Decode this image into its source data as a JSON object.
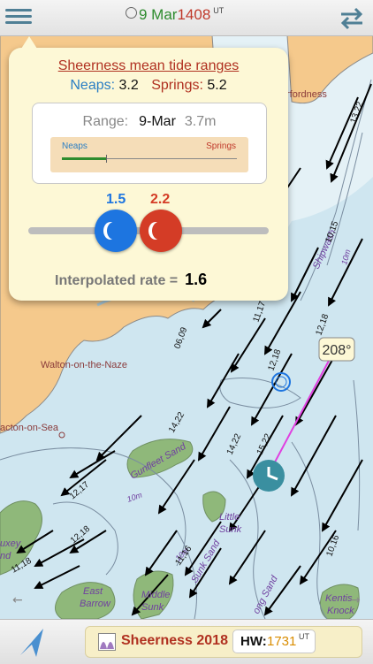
{
  "topbar": {
    "date": "9 Mar",
    "time": "1408",
    "time_suffix": "UT",
    "menu_icon": "hamburger-menu-icon",
    "swap_icon": "swap-arrows-icon"
  },
  "map": {
    "labels": {
      "walton": "Walton-on-the-Naze",
      "clacton": "acton-on-Sea",
      "gunfleet": "Gunfleet Sand",
      "little_sunk_1": "Little",
      "little_sunk_2": "Sunk",
      "middle_sunk_1": "Middle",
      "middle_sunk_2": "Sunk",
      "east_barrow_1": "East",
      "east_barrow_2": "Barrow",
      "kentish_1": "Kentis",
      "kentish_2": "Knock",
      "uxey_1": "uxey",
      "uxey_2": "nd",
      "shipwash": "Shipwash",
      "sunk_sand": "Sunk Sand",
      "long_sand": "ong Sand",
      "harfordness": "rfordness",
      "depth_10m_a": "10m",
      "depth_10m_b": "10m",
      "depth_10m_c": "10m"
    },
    "rates": [
      "13,22",
      "10,15",
      "12,18",
      "11,17",
      "06,09",
      "12,18",
      "14,22",
      "14,22",
      "15,22",
      "12,17",
      "12,18",
      "11,16",
      "11,18",
      "10,16"
    ],
    "heading": "208°",
    "colors": {
      "land": "#f5c98c",
      "sea": "#cfe6f0",
      "shallow": "#8fb87a",
      "track": "#e040e0",
      "vessel": "#3a8fa0"
    }
  },
  "popup": {
    "title": "Sheerness mean tide ranges",
    "neaps_label": "Neaps:",
    "neaps_value": "3.2",
    "springs_label": "Springs:",
    "springs_value": "5.2",
    "range_label": "Range:",
    "range_date": "9-Mar",
    "range_value": "3.7m",
    "bar_neaps": "Neaps",
    "bar_springs": "Springs",
    "bar_fraction": 0.25,
    "slider_neaps": "1.5",
    "slider_springs": "2.2",
    "interp_label": "Interpolated rate =",
    "interp_value": "1.6"
  },
  "bottombar": {
    "nav_icon": "navigation-arrow-icon",
    "station": "Sheerness 2018",
    "hw_label": "HW:",
    "hw_time": "1731",
    "hw_suffix": "UT"
  }
}
